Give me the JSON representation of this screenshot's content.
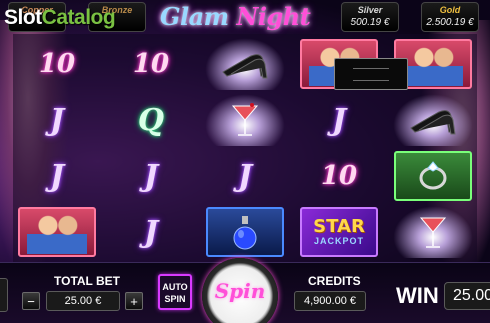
{
  "watermark": {
    "part1": "Slot",
    "part2": "Catalog"
  },
  "top_bar": {
    "logo": {
      "part1": "Glam",
      "part2": "Night"
    },
    "jackpots": [
      {
        "name": "Copper",
        "value": ""
      },
      {
        "name": "Bronze",
        "value": ""
      },
      {
        "name": "Silver",
        "value": "500.19 €"
      },
      {
        "name": "Gold",
        "value": "2.500.19 €"
      }
    ]
  },
  "reels": {
    "symbols": {
      "ten": "10",
      "j": "J",
      "q": "Q",
      "star_top": "STAR",
      "star_bottom": "JACKPOT"
    },
    "icons": [
      "high-heels-icon",
      "martini-icon",
      "ring-icon",
      "perfume-icon",
      "couple-icon"
    ]
  },
  "bottom_bar": {
    "total_bet_label": "TOTAL BET",
    "total_bet_value": "25.00 €",
    "minus_label": "−",
    "plus_label": "+",
    "autospin_line1": "AUTO",
    "autospin_line2": "SPIN",
    "spin_label": "Spin",
    "credits_label": "CREDITS",
    "credits_value": "4,900.00 €",
    "win_label": "WIN",
    "win_value": "25.00"
  },
  "colors": {
    "accent_pink": "#ff4fd8",
    "accent_purple": "#b36bff",
    "watermark_green": "#7ac142"
  }
}
